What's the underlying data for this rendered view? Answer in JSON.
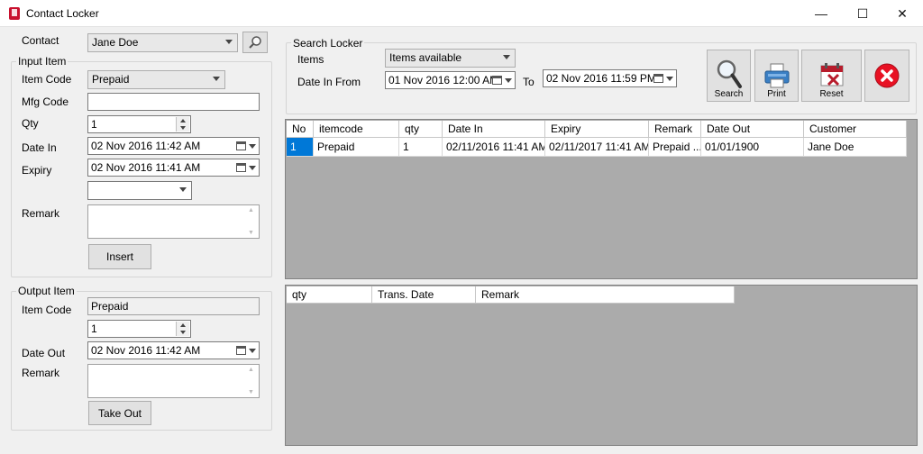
{
  "window": {
    "title": "Contact Locker",
    "minimize_glyph": "—",
    "maximize_glyph": "☐",
    "close_glyph": "✕"
  },
  "contact": {
    "label": "Contact",
    "value": "Jane Doe"
  },
  "input_item": {
    "group_label": "Input Item",
    "item_code_label": "Item Code",
    "item_code_value": "Prepaid",
    "mfg_code_label": "Mfg Code",
    "mfg_code_value": "",
    "qty_label": "Qty",
    "qty_value": "1",
    "date_in_label": "Date In",
    "date_in_value": "02 Nov 2016 11:42 AM",
    "expiry_label": "Expiry",
    "expiry_value": "02 Nov 2016 11:41 AM",
    "extra_combo_value": "",
    "remark_label": "Remark",
    "remark_value": "",
    "insert_label": "Insert"
  },
  "output_item": {
    "group_label": "Output Item",
    "item_code_label": "Item Code",
    "item_code_value": "Prepaid",
    "qty_value": "1",
    "date_out_label": "Date Out",
    "date_out_value": "02 Nov 2016 11:42 AM",
    "remark_label": "Remark",
    "remark_value": "",
    "take_out_label": "Take Out"
  },
  "search_locker": {
    "group_label": "Search Locker",
    "items_label": "Items",
    "items_value": "Items available",
    "date_from_label": "Date In From",
    "date_from_value": "01 Nov 2016 12:00 AM",
    "to_label": "To",
    "date_to_value": "02 Nov 2016 11:59 PM"
  },
  "toolbar": {
    "search_label": "Search",
    "print_label": "Print",
    "reset_label": "Reset"
  },
  "items_grid": {
    "columns": [
      "No",
      "itemcode",
      "qty",
      "Date In",
      "Expiry",
      "Remark",
      "Date Out",
      "Customer"
    ],
    "rows": [
      [
        "1",
        "Prepaid",
        "1",
        "02/11/2016 11:41 AM",
        "02/11/2017 11:41 AM",
        "Prepaid ...",
        "01/01/1900",
        "Jane Doe"
      ]
    ]
  },
  "trans_grid": {
    "columns": [
      "qty",
      "Trans. Date",
      "Remark"
    ]
  },
  "colors": {
    "selection": "#0078d7",
    "grid_background": "#ababab",
    "close_button_red": "#e81123"
  }
}
